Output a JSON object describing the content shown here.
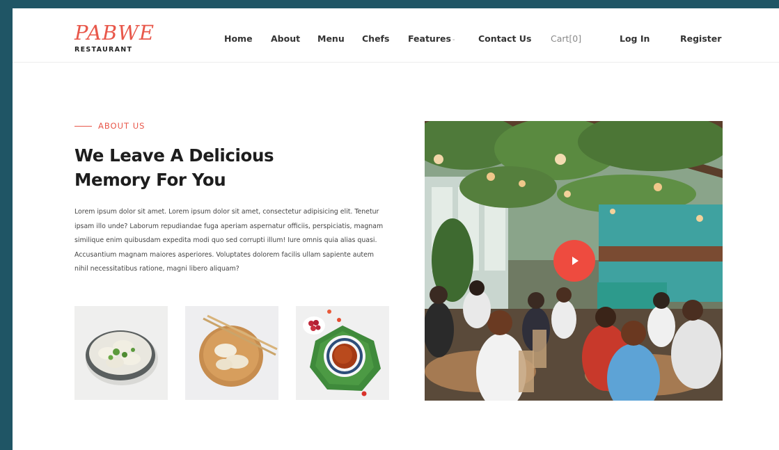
{
  "brand": {
    "name": "PABWE",
    "subtitle": "RESTAURANT",
    "accent_color": "#e8574a",
    "frame_color": "#1f5565"
  },
  "nav": {
    "home": "Home",
    "about": "About",
    "menu": "Menu",
    "chefs": "Chefs",
    "features": "Features",
    "features_caret": "-",
    "contact": "Contact Us",
    "cart": "Cart[0]",
    "login": "Log In",
    "register": "Register"
  },
  "about": {
    "eyebrow": "ABOUT US",
    "headline_line1": "We Leave A Delicious",
    "headline_line2": "Memory For You",
    "body": "Lorem ipsum dolor sit amet. Lorem ipsum dolor sit amet, consectetur adipisicing elit. Tenetur ipsam illo unde? Laborum repudiandae fuga aperiam aspernatur officiis, perspiciatis, magnam similique enim quibusdam expedita modi quo sed corrupti illum! Iure omnis quia alias quasi. Accusantium magnam maiores asperiores. Voluptates dolorem facilis ullam sapiente autem nihil necessitatibus ratione, magni libero aliquam?"
  },
  "gallery": {
    "thumbnails": [
      "dumplings-bowl",
      "dumplings-plate-chopsticks",
      "tea-cup-berries"
    ],
    "hero_image": "restaurant-dining-room",
    "play_icon": "play-icon",
    "play_color": "#ee4b3f"
  }
}
